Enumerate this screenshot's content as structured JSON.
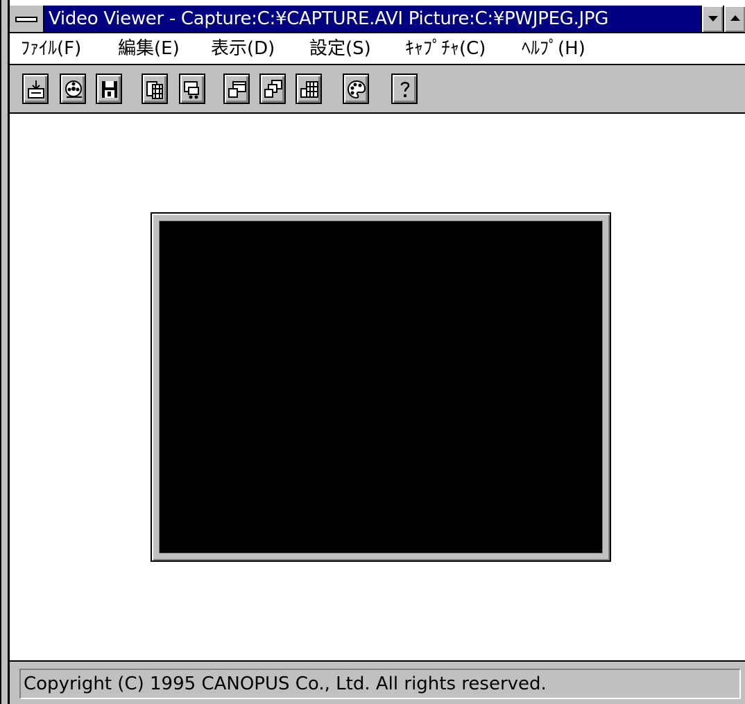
{
  "window": {
    "title": "Video Viewer - Capture:C:¥CAPTURE.AVI Picture:C:¥PWJPEG.JPG"
  },
  "menu": [
    {
      "label": "ﾌｧｲﾙ(F)"
    },
    {
      "label": "編集(E)"
    },
    {
      "label": "表示(D)"
    },
    {
      "label": "設定(S)"
    },
    {
      "label": "ｷｬﾌﾟﾁｬ(C)"
    },
    {
      "label": "ﾍﾙﾌﾟ(H)"
    }
  ],
  "toolbar": {
    "buttons": [
      {
        "icon": "open-icon"
      },
      {
        "icon": "film-reel-icon"
      },
      {
        "icon": "save-disk-icon"
      },
      {
        "icon": "film-strip-icon"
      },
      {
        "icon": "capture-icon"
      },
      {
        "icon": "window-icon"
      },
      {
        "icon": "overlay-icon"
      },
      {
        "icon": "sequence-icon"
      },
      {
        "icon": "palette-icon"
      },
      {
        "icon": "help-icon"
      }
    ]
  },
  "status": {
    "text": "Copyright (C) 1995 CANOPUS Co., Ltd. All rights reserved."
  },
  "colors": {
    "titlebar": "#000080",
    "face": "#c0c0c0",
    "video": "#000000"
  }
}
